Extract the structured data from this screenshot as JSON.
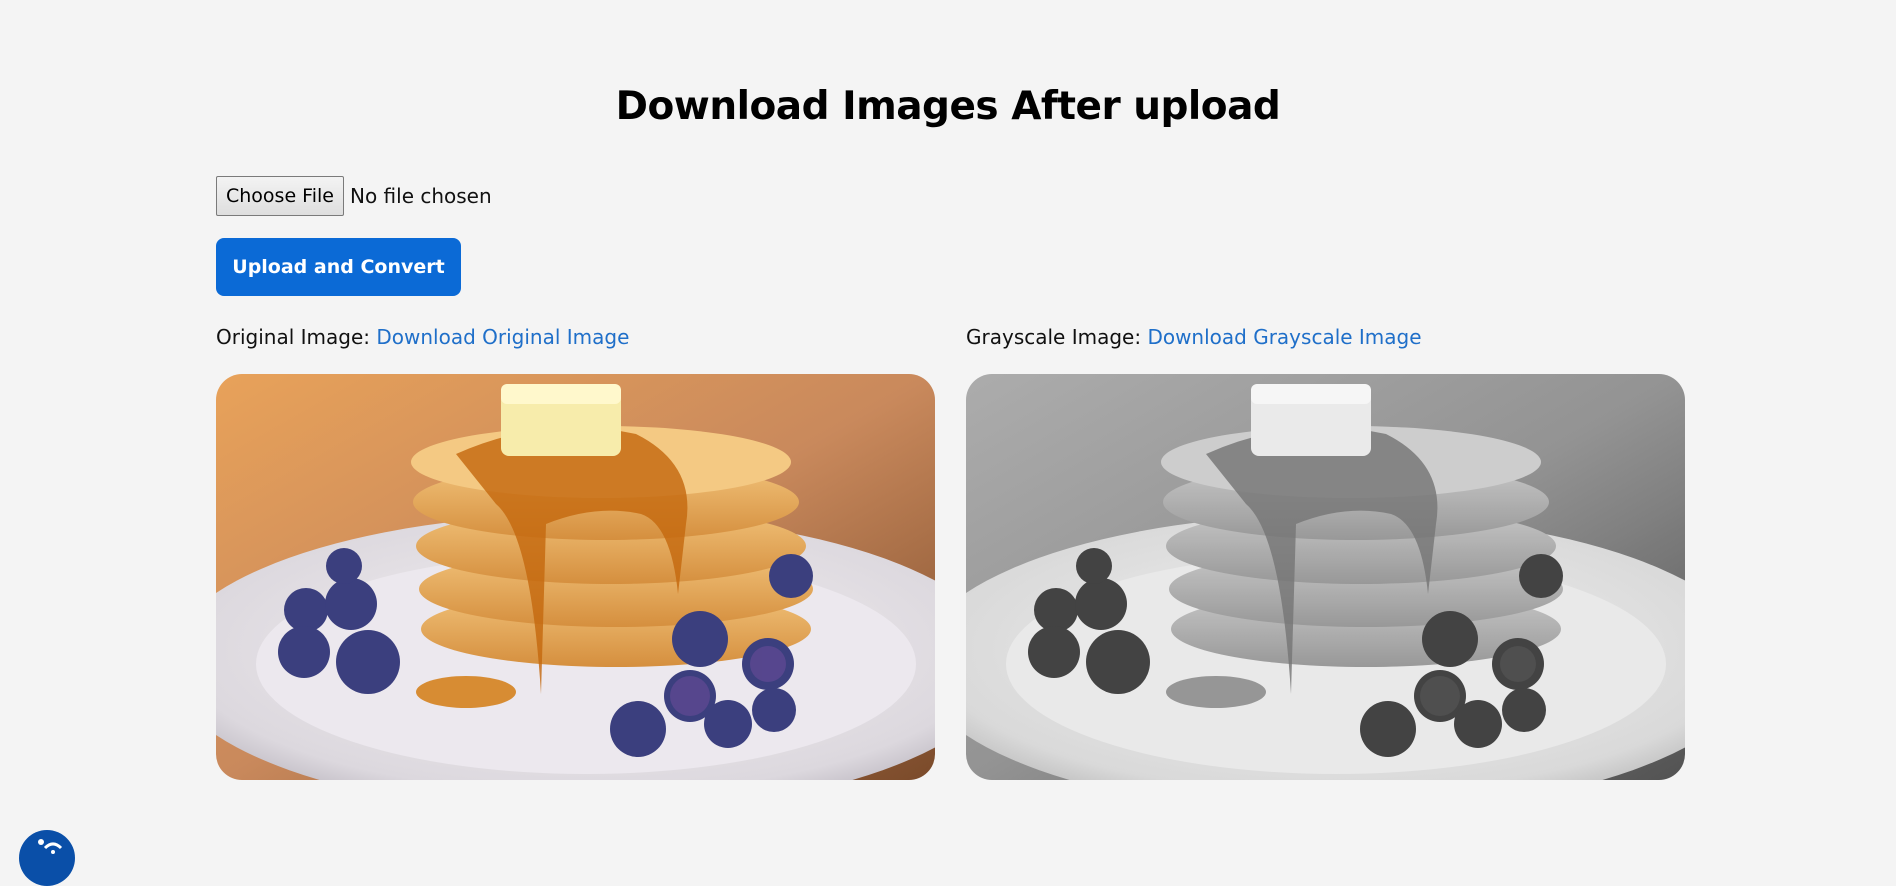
{
  "page": {
    "title": "Download Images After upload"
  },
  "upload_form": {
    "choose_file_label": "Choose File",
    "file_status": "No file chosen",
    "upload_button_label": "Upload and Convert"
  },
  "original": {
    "caption": "Original Image:",
    "download_link": "Download Original Image"
  },
  "grayscale": {
    "caption": "Grayscale Image:",
    "download_link": "Download Grayscale Image"
  },
  "widgets": {
    "accessibility_icon": "accessibility-icon",
    "accessibility_color": "#0a4fa8"
  },
  "colors": {
    "background": "#f4f4f4",
    "primary_button": "#0b6ad6",
    "link": "#1f6fc9"
  }
}
